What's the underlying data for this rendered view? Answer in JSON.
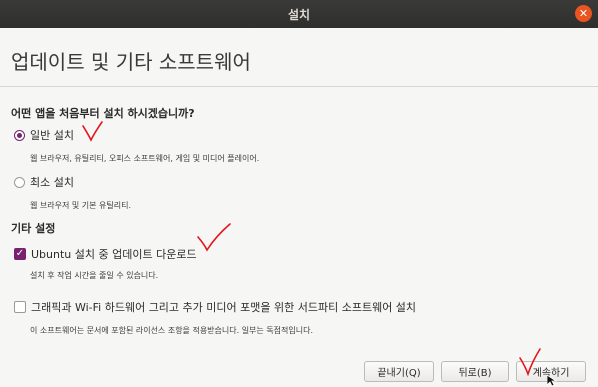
{
  "window": {
    "title": "설치",
    "close_icon": "close-icon"
  },
  "page": {
    "title": "업데이트 및 기타 소프트웨어"
  },
  "apps_section": {
    "question": "어떤 앱을 처음부터 설치 하시겠습니까?",
    "options": [
      {
        "label": "일반 설치",
        "description": "웹 브라우저, 유틸리티, 오피스 소프트웨어, 게임 및 미디어 플레이어.",
        "selected": true
      },
      {
        "label": "최소 설치",
        "description": "웹 브라우저 및 기본 유틸리티.",
        "selected": false
      }
    ]
  },
  "other_section": {
    "heading": "기타 설정",
    "options": [
      {
        "label": "Ubuntu 설치 중 업데이트 다운로드",
        "description": "설치 후 작업 시간을 줄일 수 있습니다.",
        "checked": true
      },
      {
        "label": "그래픽과 Wi-Fi 하드웨어 그리고 추가 미디어 포맷을 위한 서드파티 소프트웨어 설치",
        "description": "이 소프트웨어는 문서에 포함된 라이선스 조항을 적용받습니다. 일부는 독점적입니다.",
        "checked": false
      }
    ]
  },
  "buttons": {
    "quit": "끝내기(Q)",
    "back": "뒤로(B)",
    "continue": "계속하기"
  },
  "colors": {
    "accent": "#77216f",
    "close": "#e95420",
    "annotation": "#e4141b"
  }
}
